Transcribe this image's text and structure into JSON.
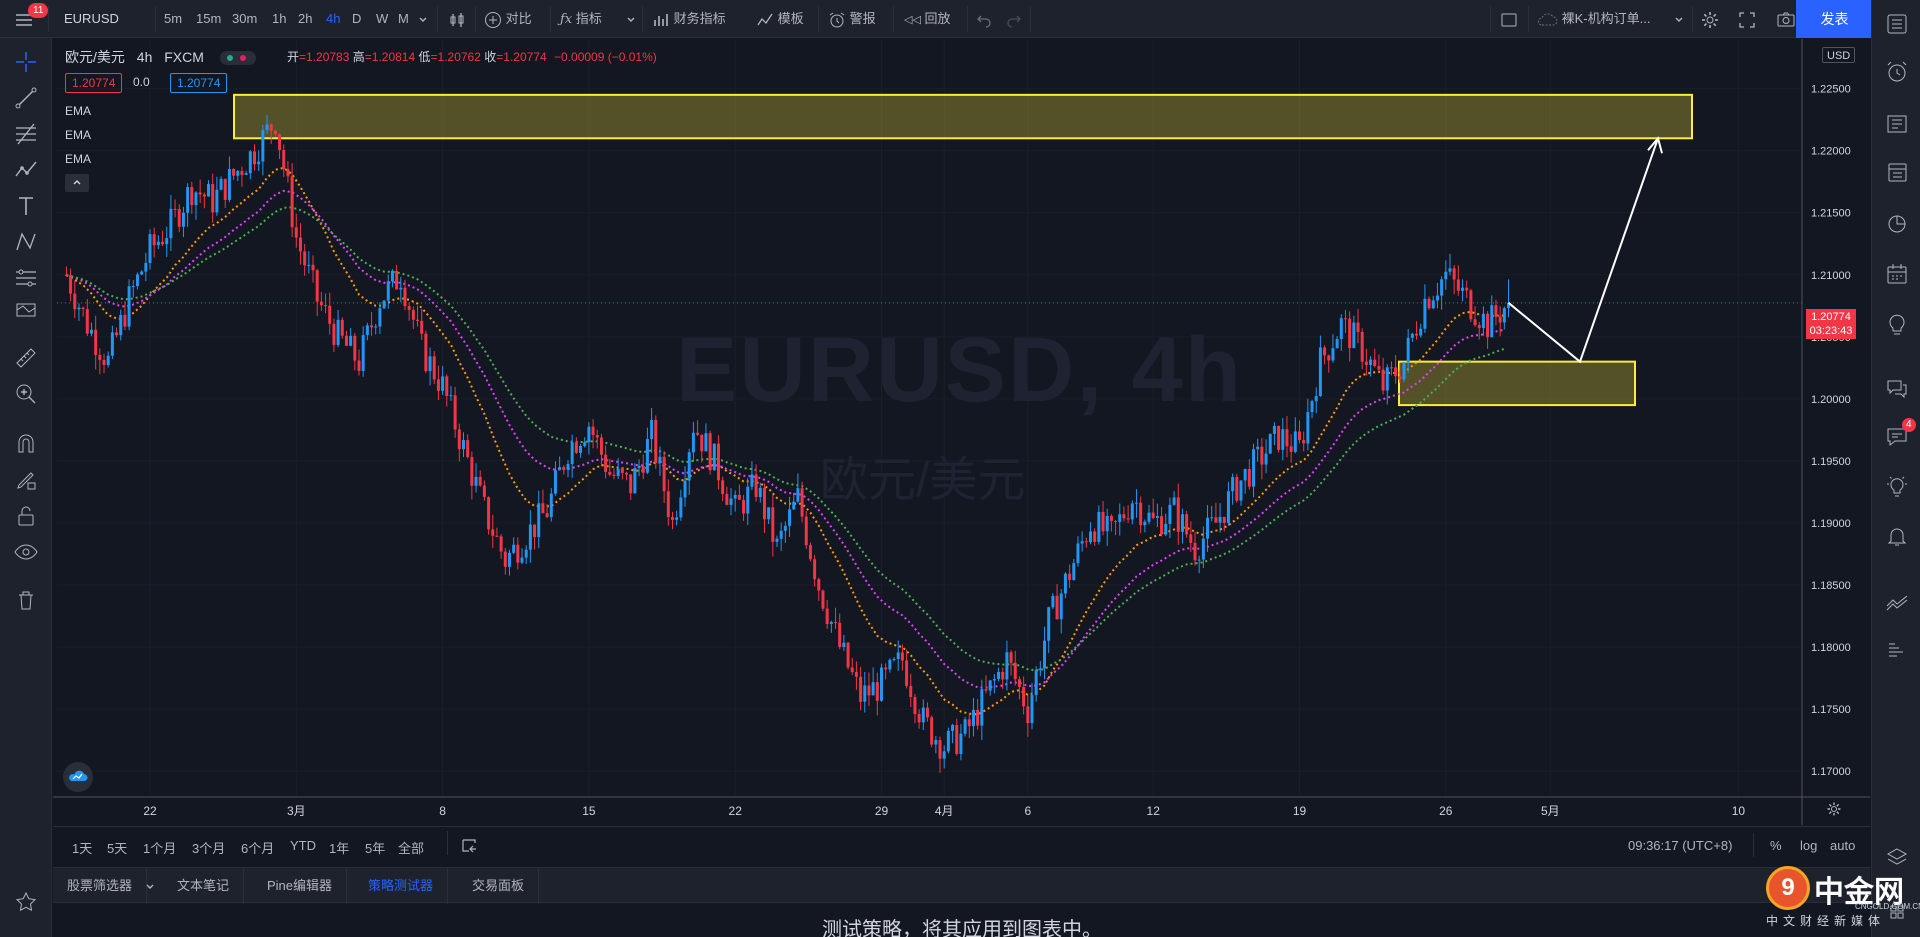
{
  "topbar": {
    "notifications_count": "11",
    "symbol": "EURUSD",
    "intervals": [
      "5m",
      "15m",
      "30m",
      "1h",
      "2h",
      "4h",
      "D",
      "W",
      "M"
    ],
    "active_interval": "4h",
    "compare_label": "对比",
    "indicators_label": "指标",
    "financials_label": "财务指标",
    "templates_label": "模板",
    "alert_label": "警报",
    "replay_label": "回放",
    "layout_name": "裸K-机构订单...",
    "publish_label": "发表",
    "accent_color": "#2962ff"
  },
  "legend": {
    "title": "欧元/美元",
    "interval": "4h",
    "source": "FXCM",
    "open_label": "开",
    "open": "=1.20783",
    "high_label": "高",
    "high": "=1.20814",
    "low_label": "低",
    "low": "=1.20762",
    "close_label": "收",
    "close": "=1.20774",
    "change": "−0.00009 (−0.01%)",
    "bid": "1.20774",
    "spread": "0.0",
    "ask": "1.20774",
    "indicators": [
      "EMA",
      "EMA",
      "EMA"
    ]
  },
  "watermark": {
    "main": "EURUSD, 4h",
    "sub": "欧元/美元"
  },
  "price_axis": {
    "currency": "USD",
    "current_price": "1.20774",
    "countdown": "03:23:43",
    "up_color": "#2196f3",
    "down_color": "#f23645"
  },
  "chart_data": {
    "type": "candlestick",
    "title": "EURUSD, 4h",
    "ylim": [
      1.168,
      1.229
    ],
    "y_ticks": [
      "1.22500",
      "1.22000",
      "1.21500",
      "1.21000",
      "1.20500",
      "1.20000",
      "1.19500",
      "1.19000",
      "1.18500",
      "1.18000",
      "1.17500",
      "1.17000"
    ],
    "y_tick_values": [
      1.225,
      1.22,
      1.215,
      1.21,
      1.205,
      1.2,
      1.195,
      1.19,
      1.185,
      1.18,
      1.175,
      1.17
    ],
    "x_ticks": [
      "22",
      "3月",
      "8",
      "15",
      "22",
      "29",
      "4月",
      "6",
      "12",
      "19",
      "26",
      "5月",
      "10"
    ],
    "x_tick_days": [
      0,
      7,
      14,
      21,
      28,
      35,
      38,
      42,
      48,
      55,
      62,
      67,
      76
    ],
    "x_days_origin": "22",
    "price_path": {
      "days": [
        -4,
        -3,
        -2,
        -1,
        0,
        1,
        2,
        3,
        4,
        5,
        6,
        7,
        8,
        9,
        10,
        11,
        12,
        13,
        14,
        15,
        16,
        17,
        18,
        19,
        20,
        21,
        22,
        23,
        24,
        25,
        26,
        27,
        28,
        29,
        30,
        31,
        32,
        33,
        34,
        35,
        36,
        37,
        38,
        39,
        40,
        41,
        42,
        43,
        44,
        45,
        46,
        47,
        48,
        49,
        50,
        51,
        52,
        53,
        54,
        55,
        56,
        57,
        58,
        59,
        60,
        61,
        62,
        63,
        64,
        65
      ],
      "close": [
        1.21,
        1.206,
        1.203,
        1.208,
        1.212,
        1.214,
        1.217,
        1.216,
        1.218,
        1.22,
        1.2225,
        1.213,
        1.208,
        1.205,
        1.203,
        1.208,
        1.21,
        1.204,
        1.201,
        1.196,
        1.191,
        1.187,
        1.189,
        1.191,
        1.196,
        1.198,
        1.194,
        1.193,
        1.197,
        1.19,
        1.198,
        1.195,
        1.191,
        1.193,
        1.188,
        1.192,
        1.185,
        1.18,
        1.176,
        1.177,
        1.179,
        1.174,
        1.172,
        1.173,
        1.176,
        1.179,
        1.175,
        1.182,
        1.186,
        1.19,
        1.189,
        1.192,
        1.19,
        1.191,
        1.188,
        1.19,
        1.193,
        1.195,
        1.197,
        1.196,
        1.203,
        1.206,
        1.204,
        1.201,
        1.203,
        1.208,
        1.21,
        1.208,
        1.206,
        1.2077
      ]
    },
    "current_price": 1.20774,
    "ema_series": [
      {
        "color": "#ff9800"
      },
      {
        "color": "#e040fb"
      },
      {
        "color": "#4caf50"
      }
    ],
    "resistance_zone": [
      1.221,
      1.2245
    ],
    "support_zone": [
      1.1995,
      1.203
    ],
    "zone_color": "#ffeb3b"
  },
  "time_axis_readout": "09:36:17 (UTC+8)",
  "range_bar": {
    "ranges": [
      "1天",
      "5天",
      "1个月",
      "3个月",
      "6个月",
      "YTD",
      "1年",
      "5年",
      "全部"
    ],
    "percent_label": "%",
    "log_label": "log",
    "auto_label": "auto"
  },
  "bottom_panel": {
    "tabs": [
      "股票筛选器",
      "文本笔记",
      "Pine编辑器",
      "策略测试器",
      "交易面板"
    ],
    "active_tab": "策略测试器",
    "message": "测试策略，将其应用到图表中。"
  },
  "right_panel": {
    "badge_count": "4"
  },
  "watermark_brand": {
    "name": "中金网",
    "domain": "CNGOLD.COM.CN",
    "slogan": "中文财经新媒体"
  }
}
